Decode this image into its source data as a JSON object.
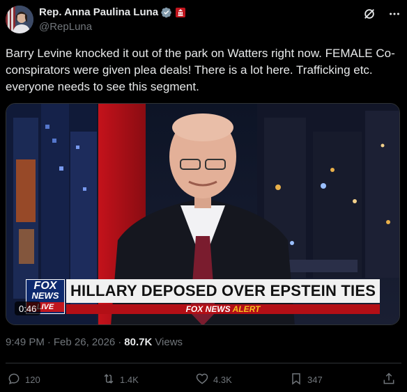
{
  "author": {
    "display_name": "Rep. Anna Paulina Luna",
    "handle": "@RepLuna"
  },
  "post": {
    "text": "Barry Levine knocked it out of the park on Watters right now. FEMALE Co-conspirators were given plea deals! There is a lot here. Trafficking etc. everyone needs to see this segment."
  },
  "media": {
    "headline": "HILLARY DEPOSED OVER EPSTEIN TIES",
    "alert_brand": "FOX NEWS",
    "alert_word": "ALERT",
    "logo_line1": "FOX",
    "logo_line2": "NEWS",
    "logo_line3": "LIVE",
    "duration": "0:46"
  },
  "meta": {
    "time": "9:49 PM",
    "separator1": "·",
    "date": "Feb 26, 2026",
    "separator2": "·",
    "views_count": "80.7K",
    "views_label": "Views"
  },
  "actions": {
    "replies": "120",
    "reposts": "1.4K",
    "likes": "4.3K",
    "bookmarks": "347"
  },
  "colors": {
    "background": "#000000",
    "text_primary": "#e7e9ea",
    "text_secondary": "#71767b",
    "verified": "#829aab",
    "gov_badge": "#c1161e",
    "divider": "#2f3336"
  },
  "icons": [
    "verified-badge-icon",
    "gov-badge-icon",
    "grok-icon",
    "more-icon",
    "reply-icon",
    "repost-icon",
    "like-icon",
    "bookmark-icon",
    "share-icon"
  ]
}
